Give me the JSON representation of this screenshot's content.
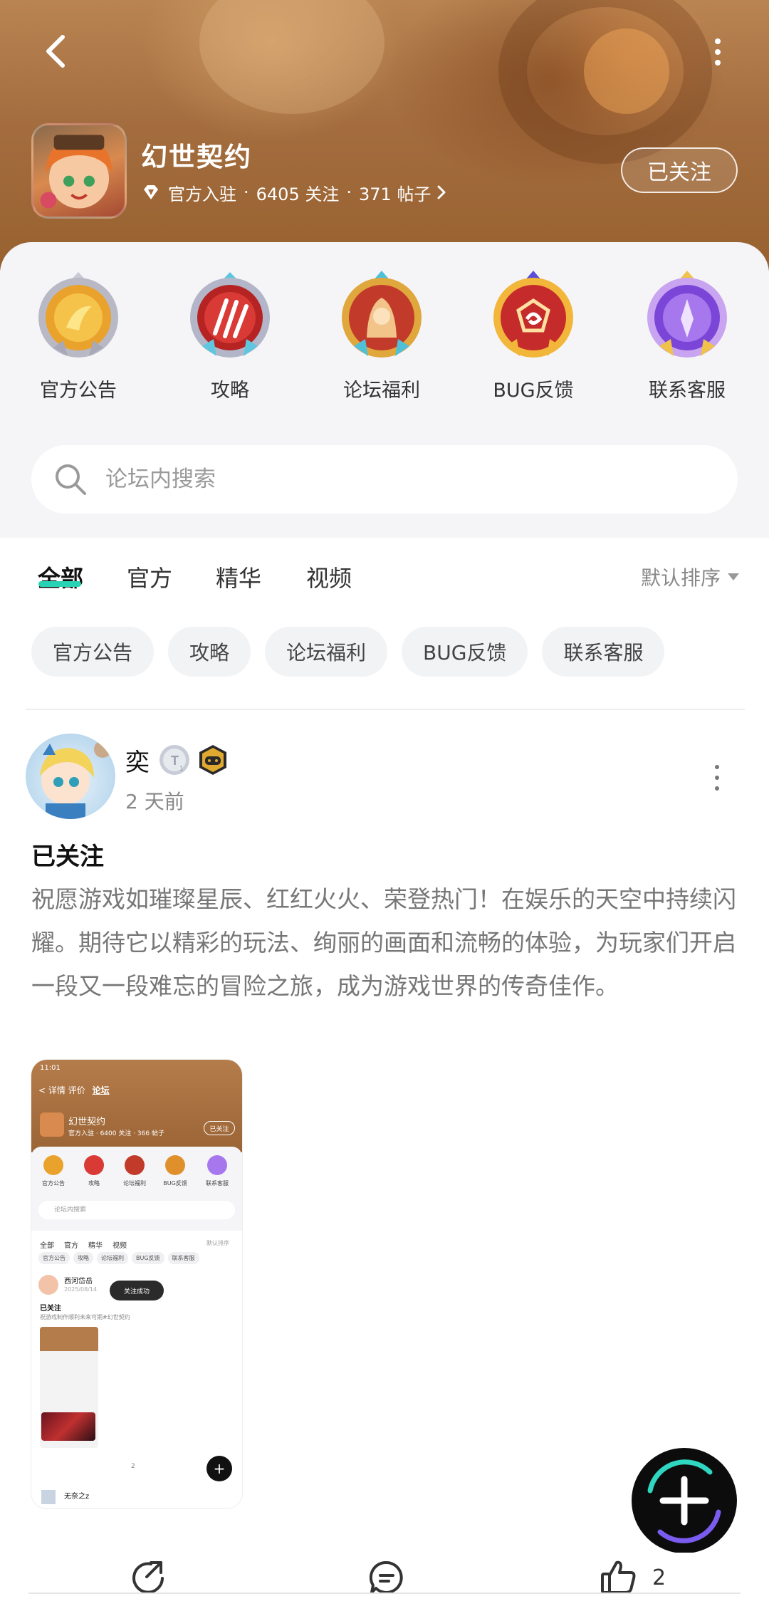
{
  "header": {
    "game_title": "幻世契约",
    "verified_label": "官方入驻",
    "follow_count": "6405 关注",
    "post_count": "371 帖子",
    "follow_button": "已关注"
  },
  "categories": [
    {
      "label": "官方公告",
      "icon": "announcement-medal-icon"
    },
    {
      "label": "攻略",
      "icon": "guide-claw-medal-icon"
    },
    {
      "label": "论坛福利",
      "icon": "welfare-hood-medal-icon"
    },
    {
      "label": "BUG反馈",
      "icon": "bug-spiral-medal-icon"
    },
    {
      "label": "联系客服",
      "icon": "support-crystal-medal-icon"
    }
  ],
  "search": {
    "placeholder": "论坛内搜索"
  },
  "tabs": [
    {
      "label": "全部",
      "active": true
    },
    {
      "label": "官方",
      "active": false
    },
    {
      "label": "精华",
      "active": false
    },
    {
      "label": "视频",
      "active": false
    }
  ],
  "sort_label": "默认排序",
  "chips": [
    "官方公告",
    "攻略",
    "论坛福利",
    "BUG反馈",
    "联系客服"
  ],
  "post": {
    "author": "奕",
    "level_badge": "T1",
    "time": "2 天前",
    "title": "已关注",
    "body": "祝愿游戏如璀璨星辰、红红火火、荣登热门！在娱乐的天空中持续闪耀。期待它以精彩的玩法、绚丽的画面和流畅的体验，为玩家们开启一段又一段难忘的冒险之旅，成为游戏世界的传奇佳作。",
    "like_count": "2"
  },
  "embedded_screenshot": {
    "status_time": "11:01",
    "nav_items": [
      "详情",
      "评价",
      "论坛"
    ],
    "game_title": "幻世契约",
    "meta": "官方入驻 · 6400 关注 · 366 帖子",
    "follow_button": "已关注",
    "categories": [
      "官方公告",
      "攻略",
      "论坛福利",
      "BUG反馈",
      "联系客服"
    ],
    "search_placeholder": "论坛内搜索",
    "tabs": [
      "全部",
      "官方",
      "精华",
      "视频"
    ],
    "sort": "默认排序",
    "chips": [
      "官方公告",
      "攻略",
      "论坛福利",
      "BUG反馈",
      "联系客服"
    ],
    "post_author": "西河岱岳",
    "post_date": "2025/08/14",
    "toast": "关注成功",
    "post_title": "已关注",
    "post_body": "祝游戏制作顺利未来可期#幻世契约",
    "comment_count": "2",
    "next_author": "无奈之z"
  },
  "colors": {
    "accent": "#27d3b4",
    "header_brown": "#a46d3f",
    "panel_bg": "#f5f5f7"
  }
}
